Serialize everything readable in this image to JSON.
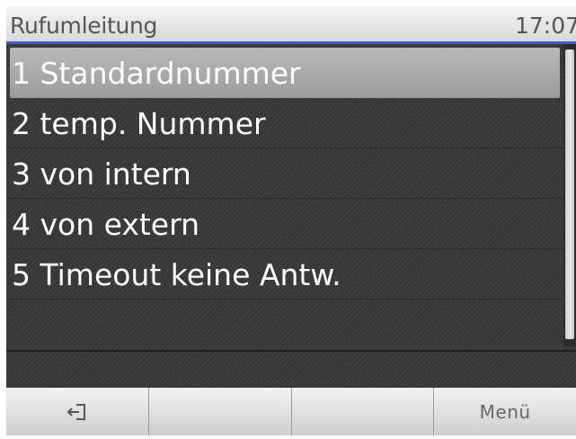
{
  "header": {
    "title": "Rufumleitung",
    "time": "17:07"
  },
  "menu": {
    "items": [
      {
        "label": "1 Standardnummer",
        "selected": true
      },
      {
        "label": "2 temp. Nummer",
        "selected": false
      },
      {
        "label": "3 von intern",
        "selected": false
      },
      {
        "label": "4 von extern",
        "selected": false
      },
      {
        "label": "5 Timeout keine Antw.",
        "selected": false
      }
    ]
  },
  "softkeys": {
    "key1_icon": "exit-icon",
    "key2_label": "",
    "key3_label": "",
    "key4_label": "Menü"
  },
  "colors": {
    "header_underline": "#3a5fcd",
    "background": "#3a3a3a"
  }
}
